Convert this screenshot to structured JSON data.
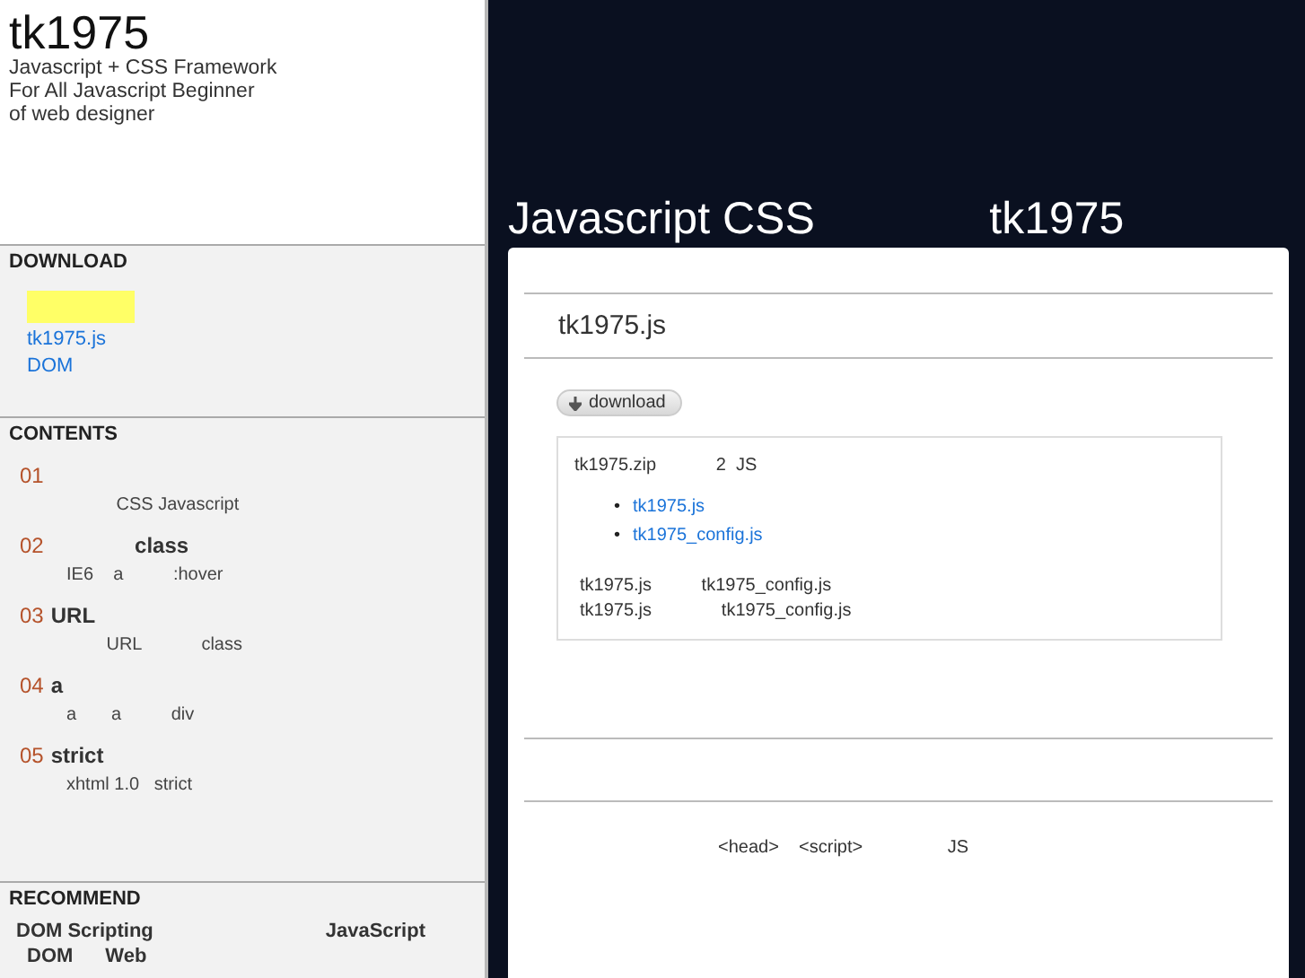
{
  "site": {
    "title": "tk1975",
    "tagline": [
      "Javascript + CSS Framework",
      "For All Javascript Beginner",
      "of web designer"
    ]
  },
  "download_section": {
    "heading": "DOWNLOAD",
    "links": [
      "tk1975.js",
      "DOM"
    ]
  },
  "contents_section": {
    "heading": "CONTENTS",
    "items": [
      {
        "number": "01",
        "desc": "          CSS Javascript"
      },
      {
        "number": "02",
        "title": "              class",
        "desc": "IE6    a          :hover"
      },
      {
        "number": "03",
        "title": "URL",
        "desc": "        URL            class"
      },
      {
        "number": "04",
        "title": "a",
        "desc": "a       a          div"
      },
      {
        "number": "05",
        "title": "strict",
        "desc": "xhtml 1.0   strict"
      }
    ]
  },
  "recommend_section": {
    "heading": "RECOMMEND",
    "books": [
      "DOM Scripting",
      "JavaScript"
    ],
    "cut_line": [
      "DOM",
      "Web"
    ]
  },
  "page_heading": "Javascript CSS              tk1975",
  "article": {
    "title": "tk1975.js",
    "download_button": "download",
    "box": {
      "intro": "tk1975.zip            2  JS",
      "files": [
        {
          "bullet": "•",
          "name": "tk1975.js"
        },
        {
          "bullet": "•",
          "name": "tk1975_config.js"
        }
      ],
      "lines": [
        "tk1975.js          tk1975_config.js",
        "tk1975.js              tk1975_config.js"
      ]
    },
    "footer_text": "<head>    <script>                 JS"
  }
}
